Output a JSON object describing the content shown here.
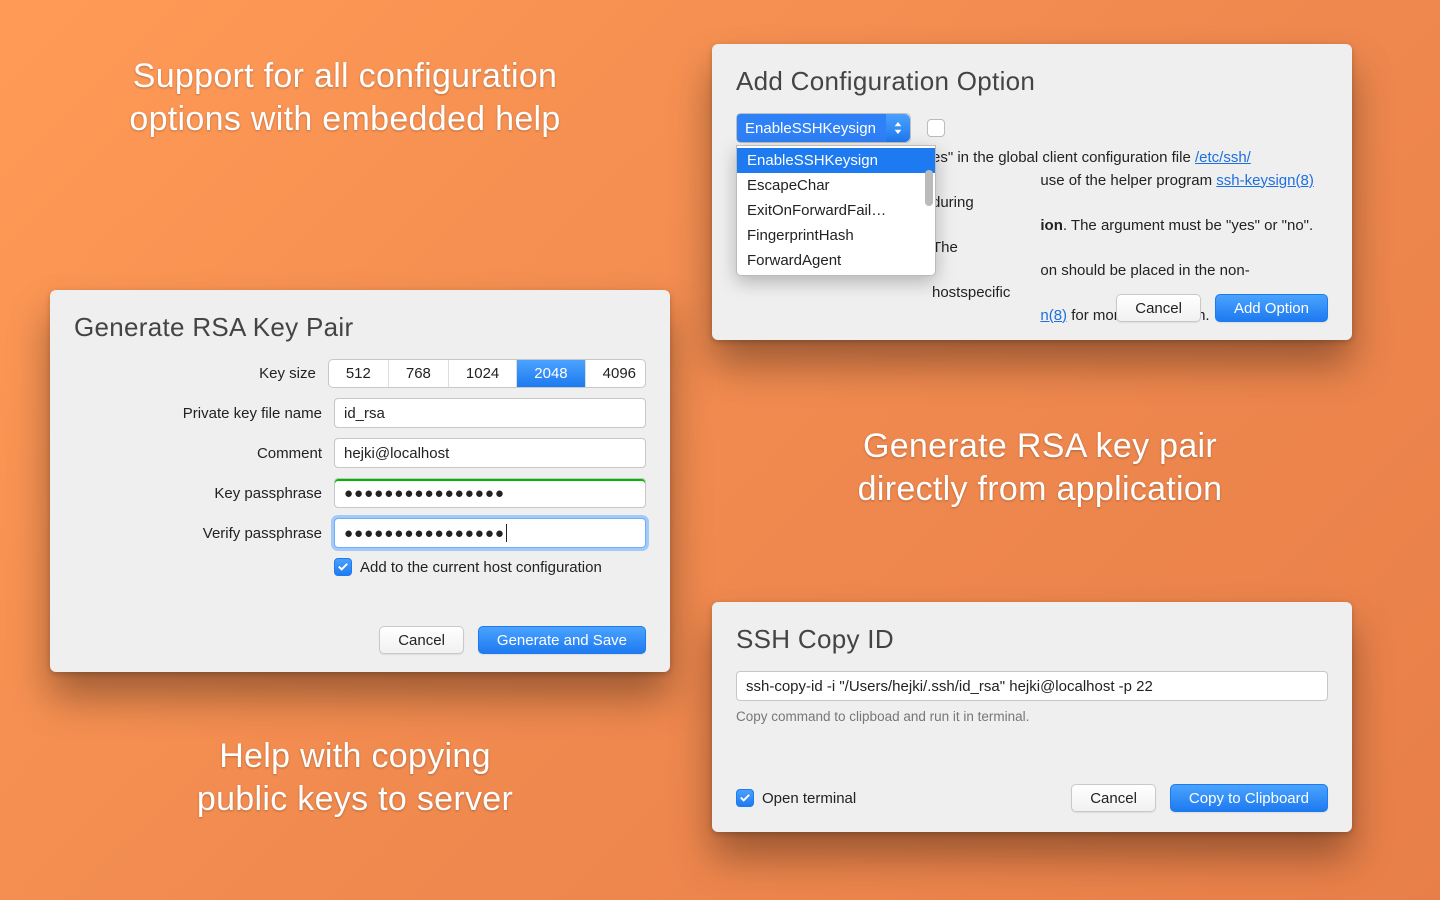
{
  "captions": {
    "c1_l1": "Support for all configuration",
    "c1_l2": "options with embedded help",
    "c2_l1": "Generate RSA key pair",
    "c2_l2": "directly from application",
    "c3_l1": "Help with copying",
    "c3_l2": "public keys to server"
  },
  "addopt": {
    "title": "Add Configuration Option",
    "selected": "EnableSSHKeysign",
    "options": [
      "EnableSSHKeysign",
      "EscapeChar",
      "ExitOnForwardFail…",
      "FingerprintHash",
      "ForwardAgent"
    ],
    "help_pre": "es\" in the global client configuration file ",
    "help_link1": "/etc/ssh/",
    "help_mid1": "                           use of the helper program ",
    "help_link2": "ssh-keysign(8)",
    "help_mid2": " during",
    "help_line3a": "ion",
    "help_line3b": ". The argument must be \"yes\" or \"no\". The",
    "help_line4": "on should be placed in the non-hostspecific",
    "help_link3": "n(8)",
    "help_end": " for more information.",
    "cancel": "Cancel",
    "add": "Add Option"
  },
  "rsa": {
    "title": "Generate RSA Key Pair",
    "labels": {
      "keysize": "Key size",
      "private": "Private key file name",
      "comment": "Comment",
      "pass": "Key passphrase",
      "verify": "Verify passphrase",
      "addhost": "Add to the current host configuration"
    },
    "keysizes": [
      "512",
      "768",
      "1024",
      "2048",
      "4096"
    ],
    "keysize_selected": "2048",
    "private_value": "id_rsa",
    "comment_value": "hejki@localhost",
    "pass_value": "●●●●●●●●●●●●●●●●",
    "verify_value": "●●●●●●●●●●●●●●●●",
    "cancel": "Cancel",
    "generate": "Generate and Save"
  },
  "copy": {
    "title": "SSH Copy ID",
    "cmd": "ssh-copy-id -i \"/Users/hejki/.ssh/id_rsa\" hejki@localhost -p 22",
    "hint": "Copy command to clipboad and run it in terminal.",
    "open_terminal": "Open terminal",
    "cancel": "Cancel",
    "copyclip": "Copy to Clipboard"
  }
}
